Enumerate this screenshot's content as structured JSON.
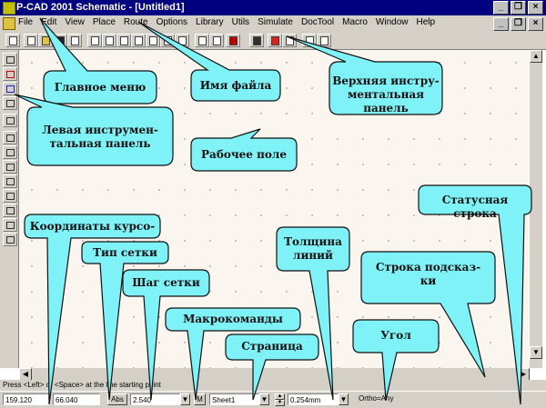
{
  "window": {
    "title": "P-CAD 2001 Schematic - [Untitled1]",
    "controls": [
      "_",
      "❐",
      "×"
    ]
  },
  "menubar": {
    "items": [
      "File",
      "Edit",
      "View",
      "Place",
      "Route",
      "Options",
      "Library",
      "Utils",
      "Simulate",
      "DocTool",
      "Macro",
      "Window",
      "Help"
    ],
    "doc_controls": [
      "_",
      "❐",
      "×"
    ]
  },
  "prompt": "Press <Left> or <Space> at the line starting point",
  "status": {
    "coord_x": "159.120",
    "coord_y": "66.040",
    "grid_type": "Abs",
    "grid_step": "2.540",
    "macro": "M",
    "sheet": "Sheet1",
    "line_width": "0.254mm",
    "angle": "Ortho=Any"
  },
  "callouts": {
    "main_menu": "Главное меню",
    "file_name": "Имя файла",
    "top_toolbar": "Верхняя инстру-\nментальная панель",
    "left_toolbar": "Левая инструмен-\nтальная панель",
    "workspace": "Рабочее поле",
    "status_line": "Статусная строка",
    "cursor_coords": "Координаты курсо-",
    "grid_type": "Тип сетки",
    "line_width": "Толщина\nлиний",
    "hint_line": "Строка подсказ-\nки",
    "grid_step": "Шаг сетки",
    "macros": "Макрокоманды",
    "page": "Страница",
    "angle": "Угол"
  }
}
